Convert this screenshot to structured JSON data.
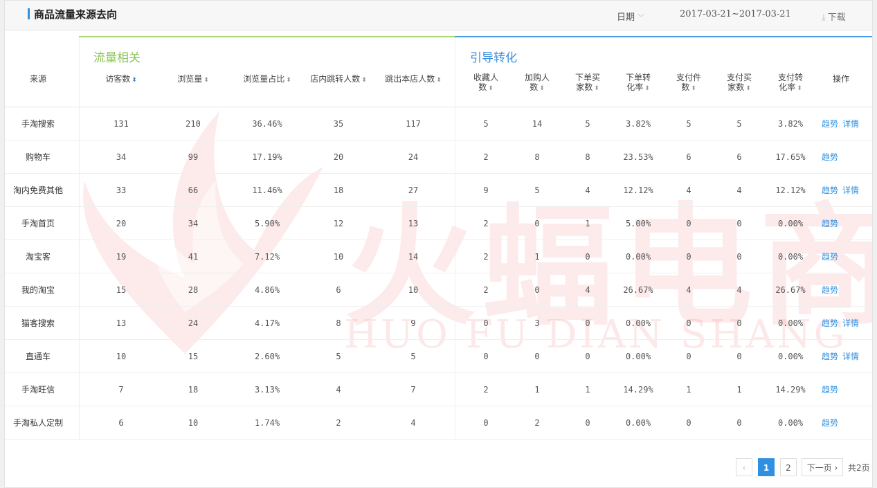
{
  "header": {
    "title": "商品流量来源去向",
    "date_label": "日期",
    "date_range": "2017-03-21~2017-03-21",
    "download_label": "下载"
  },
  "groups": {
    "traffic": "流量相关",
    "conversion": "引导转化"
  },
  "columns": [
    {
      "key": "source",
      "line1": "来源",
      "line2": "",
      "sortable": false
    },
    {
      "key": "visitors",
      "line1": "访客数",
      "line2": "",
      "sortable": true,
      "active": true
    },
    {
      "key": "pageviews",
      "line1": "浏览量",
      "line2": "",
      "sortable": true
    },
    {
      "key": "pv_share",
      "line1": "浏览量占比",
      "line2": "",
      "sortable": true
    },
    {
      "key": "in_store",
      "line1": "店内跳转人数",
      "line2": "",
      "sortable": true
    },
    {
      "key": "out_store",
      "line1": "跳出本店人数",
      "line2": "",
      "sortable": true
    },
    {
      "key": "favorites",
      "line1": "收藏人",
      "line2": "数",
      "sortable": true
    },
    {
      "key": "carts",
      "line1": "加购人",
      "line2": "数",
      "sortable": true
    },
    {
      "key": "order_buyers",
      "line1": "下单买",
      "line2": "家数",
      "sortable": true
    },
    {
      "key": "order_rate",
      "line1": "下单转",
      "line2": "化率",
      "sortable": true
    },
    {
      "key": "pay_items",
      "line1": "支付件",
      "line2": "数",
      "sortable": true
    },
    {
      "key": "pay_buyers",
      "line1": "支付买",
      "line2": "家数",
      "sortable": true
    },
    {
      "key": "pay_rate",
      "line1": "支付转",
      "line2": "化率",
      "sortable": true
    },
    {
      "key": "ops",
      "line1": "操作",
      "line2": "",
      "sortable": false
    }
  ],
  "rows": [
    {
      "source": "手淘搜索",
      "values": [
        "131",
        "210",
        "36.46%",
        "35",
        "117",
        "5",
        "14",
        "5",
        "3.82%",
        "5",
        "5",
        "3.82%"
      ],
      "ops": [
        "趋势",
        "详情"
      ]
    },
    {
      "source": "购物车",
      "values": [
        "34",
        "99",
        "17.19%",
        "20",
        "24",
        "2",
        "8",
        "8",
        "23.53%",
        "6",
        "6",
        "17.65%"
      ],
      "ops": [
        "趋势"
      ]
    },
    {
      "source": "淘内免费其他",
      "values": [
        "33",
        "66",
        "11.46%",
        "18",
        "27",
        "9",
        "5",
        "4",
        "12.12%",
        "4",
        "4",
        "12.12%"
      ],
      "ops": [
        "趋势",
        "详情"
      ]
    },
    {
      "source": "手淘首页",
      "values": [
        "20",
        "34",
        "5.90%",
        "12",
        "13",
        "2",
        "0",
        "1",
        "5.00%",
        "0",
        "0",
        "0.00%"
      ],
      "ops": [
        "趋势"
      ]
    },
    {
      "source": "淘宝客",
      "values": [
        "19",
        "41",
        "7.12%",
        "10",
        "14",
        "2",
        "1",
        "0",
        "0.00%",
        "0",
        "0",
        "0.00%"
      ],
      "ops": [
        "趋势"
      ]
    },
    {
      "source": "我的淘宝",
      "values": [
        "15",
        "28",
        "4.86%",
        "6",
        "10",
        "2",
        "0",
        "4",
        "26.67%",
        "4",
        "4",
        "26.67%"
      ],
      "ops": [
        "趋势"
      ]
    },
    {
      "source": "猫客搜索",
      "values": [
        "13",
        "24",
        "4.17%",
        "8",
        "9",
        "0",
        "3",
        "0",
        "0.00%",
        "0",
        "0",
        "0.00%"
      ],
      "ops": [
        "趋势",
        "详情"
      ]
    },
    {
      "source": "直通车",
      "values": [
        "10",
        "15",
        "2.60%",
        "5",
        "5",
        "0",
        "0",
        "0",
        "0.00%",
        "0",
        "0",
        "0.00%"
      ],
      "ops": [
        "趋势",
        "详情"
      ]
    },
    {
      "source": "手淘旺信",
      "values": [
        "7",
        "18",
        "3.13%",
        "4",
        "7",
        "2",
        "1",
        "1",
        "14.29%",
        "1",
        "1",
        "14.29%"
      ],
      "ops": [
        "趋势"
      ]
    },
    {
      "source": "手淘私人定制",
      "values": [
        "6",
        "10",
        "1.74%",
        "2",
        "4",
        "0",
        "2",
        "0",
        "0.00%",
        "0",
        "0",
        "0.00%"
      ],
      "ops": [
        "趋势"
      ]
    }
  ],
  "watermark": {
    "main": "火蝠电商",
    "sub": "HUO FU DIAN SHANG"
  },
  "pagination": {
    "prev": "‹",
    "pages": [
      "1",
      "2"
    ],
    "current": "1",
    "next": "下一页 ›",
    "total": "共2页"
  },
  "colors": {
    "accent_blue": "#2f8fe0",
    "traffic_green": "#8cc45a",
    "watermark_red": "#ed5a64"
  }
}
